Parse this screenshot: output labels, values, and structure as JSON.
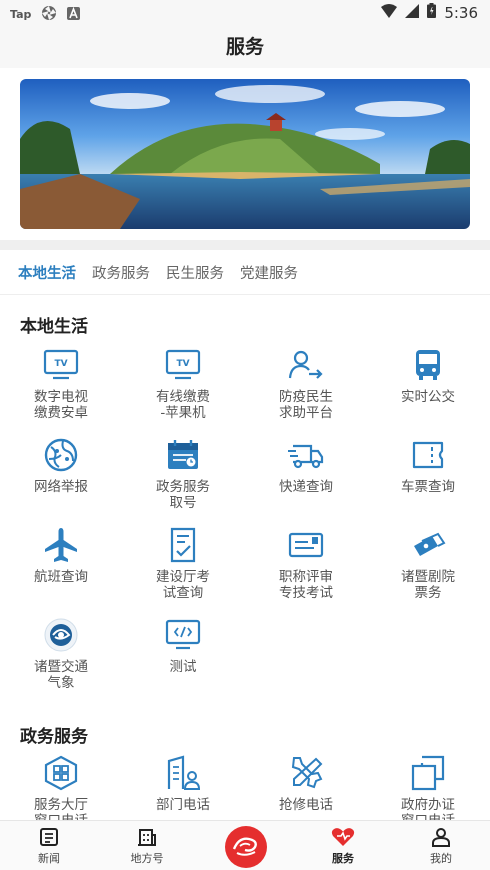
{
  "status": {
    "left_text": "Tap",
    "time": "5:36"
  },
  "header": {
    "title": "服务"
  },
  "tabs": [
    {
      "label": "本地生活",
      "active": true
    },
    {
      "label": "政务服务",
      "active": false
    },
    {
      "label": "民生服务",
      "active": false
    },
    {
      "label": "党建服务",
      "active": false
    }
  ],
  "sections": {
    "local": {
      "title": "本地生活",
      "items": [
        {
          "label": "数字电视\n缴费安卓",
          "icon": "tv-icon"
        },
        {
          "label": "有线缴费\n-苹果机",
          "icon": "tv-icon"
        },
        {
          "label": "防疫民生\n求助平台",
          "icon": "person-arrow-icon"
        },
        {
          "label": "实时公交",
          "icon": "bus-icon"
        },
        {
          "label": "网络举报",
          "icon": "globe-icon"
        },
        {
          "label": "政务服务\n取号",
          "icon": "calendar-icon"
        },
        {
          "label": "快递查询",
          "icon": "truck-icon"
        },
        {
          "label": "车票查询",
          "icon": "ticket-icon"
        },
        {
          "label": "航班查询",
          "icon": "airplane-icon"
        },
        {
          "label": "建设厅考\n试查询",
          "icon": "checklist-icon"
        },
        {
          "label": "职称评审\n专技考试",
          "icon": "card-icon"
        },
        {
          "label": "诸暨剧院\n票务",
          "icon": "tickets-icon"
        },
        {
          "label": "诸暨交通\n气象",
          "icon": "weather-logo-icon"
        },
        {
          "label": "测试",
          "icon": "code-monitor-icon"
        }
      ]
    },
    "gov": {
      "title": "政务服务",
      "items": [
        {
          "label": "服务大厅\n窗口电话",
          "icon": "hall-grid-icon"
        },
        {
          "label": "部门电话",
          "icon": "department-icon"
        },
        {
          "label": "抢修电话",
          "icon": "tools-icon"
        },
        {
          "label": "政府办证\n窗口电话",
          "icon": "copy-icon"
        }
      ]
    }
  },
  "bottom_nav": [
    {
      "label": "新闻",
      "icon": "news-icon"
    },
    {
      "label": "地方号",
      "icon": "building-icon"
    },
    {
      "label": "服务",
      "icon": "heart-icon",
      "active": true
    },
    {
      "label": "我的",
      "icon": "user-icon"
    }
  ],
  "colors": {
    "accent": "#2d7fbf",
    "brand_red": "#e52e2e"
  }
}
